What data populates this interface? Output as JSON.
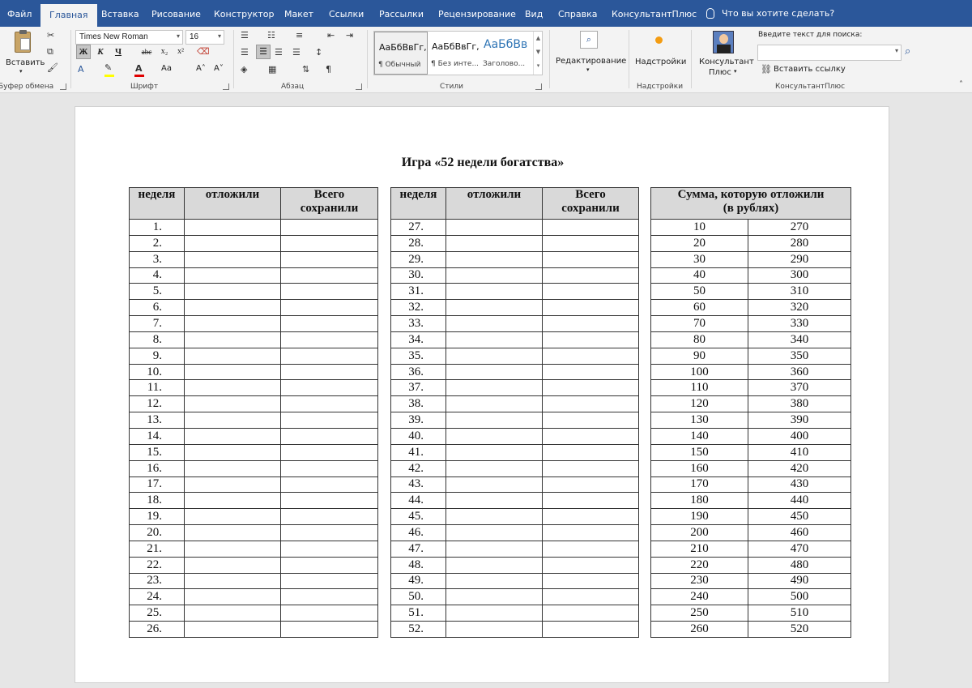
{
  "tabs": [
    "Файл",
    "Главная",
    "Вставка",
    "Рисование",
    "Конструктор",
    "Макет",
    "Ссылки",
    "Рассылки",
    "Рецензирование",
    "Вид",
    "Справка",
    "КонсультантПлюс"
  ],
  "active_tab": "Главная",
  "tell_me": "Что вы хотите сделать?",
  "ribbon": {
    "paste_label": "Вставить",
    "clipboard_group": "Буфер обмена",
    "font_name": "Times New Roman",
    "font_size": "16",
    "font_group": "Шрифт",
    "bold": "Ж",
    "italic": "К",
    "underline": "Ч",
    "strike": "abc",
    "subscript": "x₂",
    "superscript": "x²",
    "case_button": "Aa",
    "grow_font": "A˄",
    "shrink_font": "A˅",
    "paragraph_group": "Абзац",
    "styles": [
      {
        "sample": "АаБбВвГг,",
        "name": "¶ Обычный"
      },
      {
        "sample": "АаБбВвГг,",
        "name": "¶ Без инте..."
      },
      {
        "sample": "АаБбВв",
        "name": "Заголово..."
      }
    ],
    "styles_group": "Стили",
    "editing_label": "Редактирование",
    "addins_label": "Надстройки",
    "addins_group": "Надстройки",
    "consultant_label_1": "Консультант",
    "consultant_label_2": "Плюс",
    "search_caption": "Введите текст для поиска:",
    "search_value": "",
    "insert_link": "Вставить ссылку",
    "consultant_group": "КонсультантПлюс"
  },
  "document": {
    "title": "Игра «52 недели богатства»",
    "weeks_headers": {
      "week": "неделя",
      "saved": "отложили",
      "total_1": "Всего",
      "total_2": "сохранили"
    },
    "weeks_left": [
      "1.",
      "2.",
      "3.",
      "4.",
      "5.",
      "6.",
      "7.",
      "8.",
      "9.",
      "10.",
      "11.",
      "12.",
      "13.",
      "14.",
      "15.",
      "16.",
      "17.",
      "18.",
      "19.",
      "20.",
      "21.",
      "22.",
      "23.",
      "24.",
      "25.",
      "26."
    ],
    "weeks_right": [
      "27.",
      "28.",
      "29.",
      "30.",
      "31.",
      "32.",
      "33.",
      "34.",
      "35.",
      "36.",
      "37.",
      "38.",
      "39.",
      "40.",
      "41.",
      "42.",
      "43.",
      "44.",
      "45.",
      "46.",
      "47.",
      "48.",
      "49.",
      "50.",
      "51.",
      "52."
    ],
    "sum_header_1": "Сумма, которую отложили",
    "sum_header_2": "(в рублях)",
    "sums_a": [
      "10",
      "20",
      "30",
      "40",
      "50",
      "60",
      "70",
      "80",
      "90",
      "100",
      "110",
      "120",
      "130",
      "140",
      "150",
      "160",
      "170",
      "180",
      "190",
      "200",
      "210",
      "220",
      "230",
      "240",
      "250",
      "260"
    ],
    "sums_b": [
      "270",
      "280",
      "290",
      "300",
      "310",
      "320",
      "330",
      "340",
      "350",
      "360",
      "370",
      "380",
      "390",
      "400",
      "410",
      "420",
      "430",
      "440",
      "450",
      "460",
      "470",
      "480",
      "490",
      "500",
      "510",
      "520"
    ]
  }
}
